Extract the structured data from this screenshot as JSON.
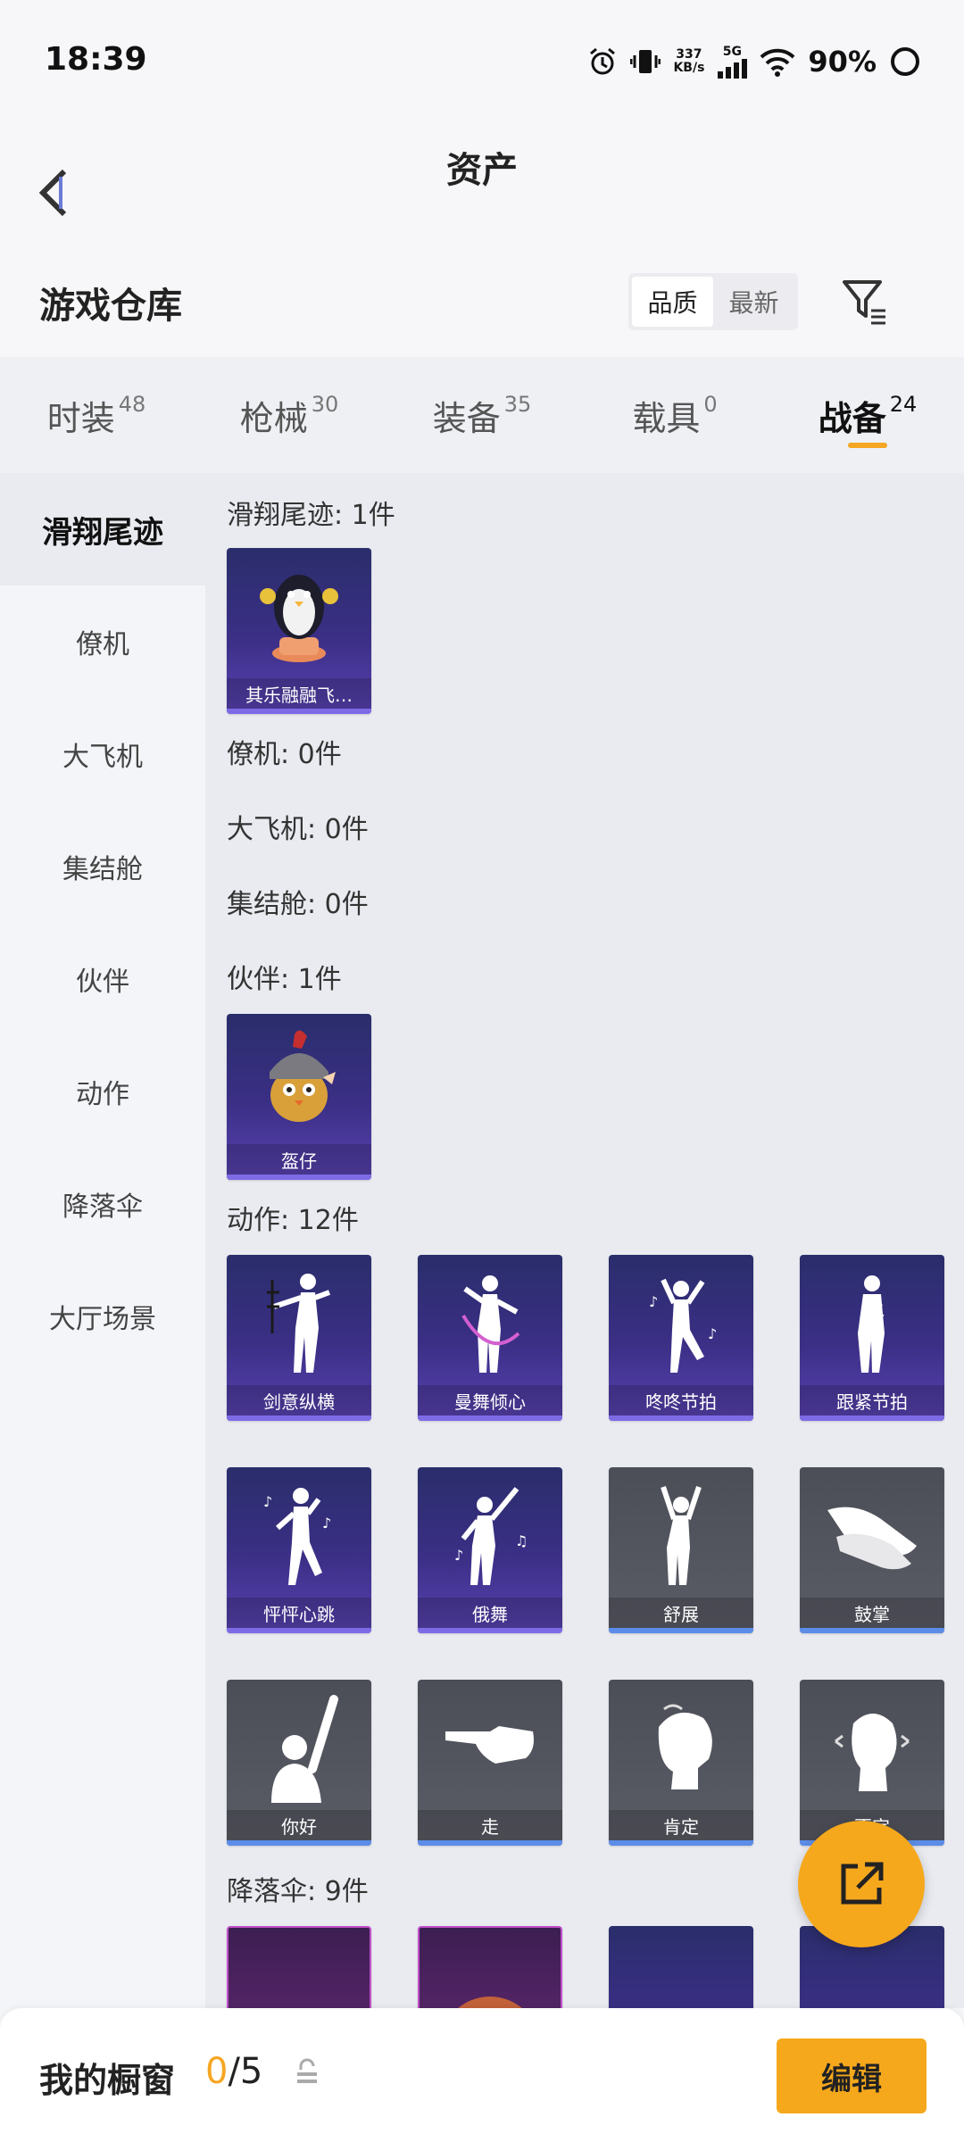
{
  "status_bar": {
    "time": "18:39",
    "speed_value": "337",
    "speed_unit": "KB/s",
    "network": "5G",
    "battery": "90%"
  },
  "nav": {
    "title": "资产",
    "back_icon": "chevron-left-icon"
  },
  "warehouse": {
    "title": "游戏仓库",
    "sort_options": [
      "品质",
      "最新"
    ],
    "sort_selected": "品质",
    "filter_icon": "filter-icon"
  },
  "tabs": [
    {
      "label": "时装",
      "count": "48"
    },
    {
      "label": "枪械",
      "count": "30"
    },
    {
      "label": "装备",
      "count": "35"
    },
    {
      "label": "载具",
      "count": "0"
    },
    {
      "label": "战备",
      "count": "24"
    }
  ],
  "active_tab": "战备",
  "sidebar": {
    "items": [
      "滑翔尾迹",
      "僚机",
      "大飞机",
      "集结舱",
      "伙伴",
      "动作",
      "降落伞",
      "大厅场景"
    ],
    "active": "滑翔尾迹"
  },
  "sections": {
    "glide_trail": {
      "label": "滑翔尾迹: 1件",
      "items": [
        "其乐融融飞…"
      ]
    },
    "wingman": {
      "label": "僚机: 0件"
    },
    "big_plane": {
      "label": "大飞机: 0件"
    },
    "assembly_pod": {
      "label": "集结舱: 0件"
    },
    "partner": {
      "label": "伙伴: 1件",
      "items": [
        "盔仔"
      ]
    },
    "emote": {
      "label": "动作: 12件",
      "items": [
        "剑意纵横",
        "曼舞倾心",
        "咚咚节拍",
        "跟紧节拍",
        "怦怦心跳",
        "俄舞",
        "舒展",
        "鼓掌",
        "你好",
        "走",
        "肯定",
        "否定"
      ]
    },
    "parachute": {
      "label": "降落伞: 9件"
    }
  },
  "footer": {
    "showcase_label": "我的橱窗",
    "showcase_current": "0",
    "showcase_total": "/5",
    "edit_label": "编辑"
  },
  "colors": {
    "accent": "#f5a81c",
    "card_purple": "#3b2f86",
    "card_grey": "#55575f"
  }
}
